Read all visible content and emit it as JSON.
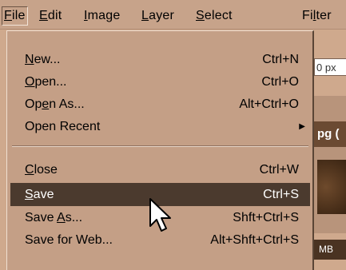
{
  "menubar": {
    "items": [
      {
        "pre": "",
        "ul": "F",
        "post": "ile"
      },
      {
        "pre": "",
        "ul": "E",
        "post": "dit"
      },
      {
        "pre": "",
        "ul": "I",
        "post": "mage"
      },
      {
        "pre": "",
        "ul": "L",
        "post": "ayer"
      },
      {
        "pre": "",
        "ul": "S",
        "post": "elect"
      },
      {
        "pre": "Fi",
        "ul": "l",
        "post": "ter"
      }
    ]
  },
  "background": {
    "field_text": "0 px",
    "bar_text": "pg (",
    "bottom_text": "MB"
  },
  "file_menu": {
    "items": [
      {
        "pre": "",
        "ul": "N",
        "post": "ew...",
        "shortcut": "Ctrl+N"
      },
      {
        "pre": "",
        "ul": "O",
        "post": "pen...",
        "shortcut": "Ctrl+O"
      },
      {
        "pre": "Op",
        "ul": "e",
        "post": "n As...",
        "shortcut": "Alt+Ctrl+O"
      },
      {
        "pre": "Open Recent",
        "ul": "",
        "post": "",
        "shortcut": "",
        "submenu_arrow": "▶"
      },
      {
        "pre": "",
        "ul": "C",
        "post": "lose",
        "shortcut": "Ctrl+W"
      },
      {
        "pre": "",
        "ul": "S",
        "post": "ave",
        "shortcut": "Ctrl+S"
      },
      {
        "pre": "Save ",
        "ul": "A",
        "post": "s...",
        "shortcut": "Shft+Ctrl+S"
      },
      {
        "pre": "Save for Web...",
        "ul": "",
        "post": "",
        "shortcut": "Alt+Shft+Ctrl+S"
      }
    ]
  },
  "colors": {
    "menu_bg": "#c49f86",
    "highlight_bg": "#4b3a2e",
    "highlight_text": "#ffffff"
  },
  "cursor_icon": "arrow-pointer-icon"
}
